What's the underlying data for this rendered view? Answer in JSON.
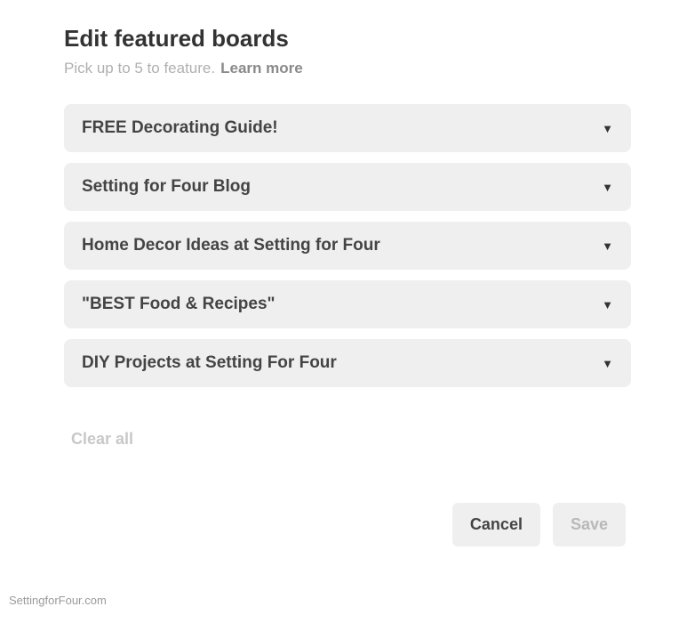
{
  "header": {
    "title": "Edit featured boards",
    "subtitle": "Pick up to 5 to feature.",
    "learn_more": "Learn more"
  },
  "boards": [
    {
      "label": "FREE Decorating Guide!"
    },
    {
      "label": "Setting for Four Blog"
    },
    {
      "label": "Home Decor Ideas at Setting for Four"
    },
    {
      "label": "\"BEST Food & Recipes\""
    },
    {
      "label": "DIY Projects at Setting For Four"
    }
  ],
  "actions": {
    "clear_all": "Clear all",
    "cancel": "Cancel",
    "save": "Save"
  },
  "watermark": "SettingforFour.com"
}
